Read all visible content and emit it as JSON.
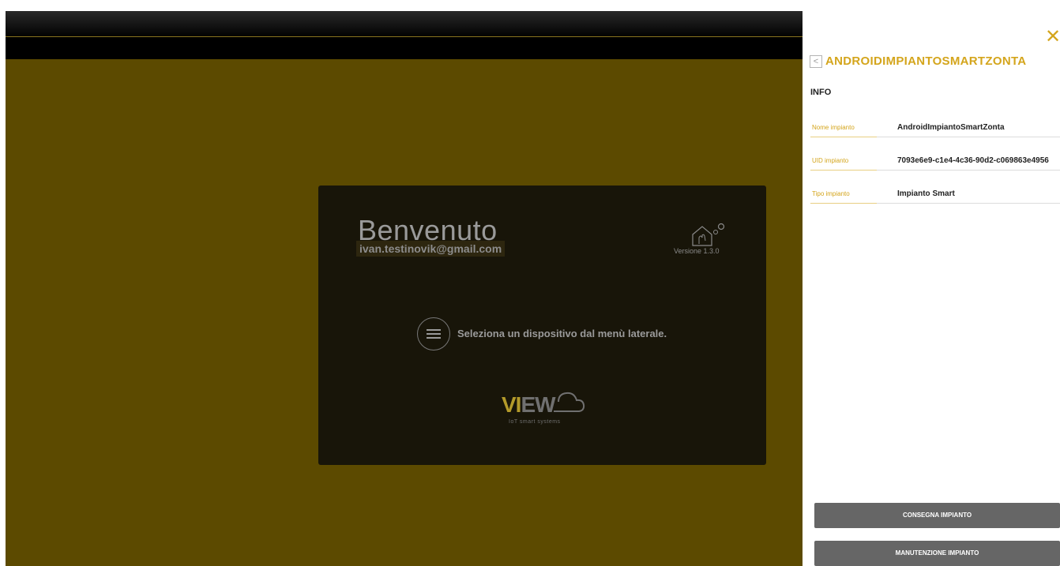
{
  "main": {
    "welcome": {
      "title": "Benvenuto",
      "email": "ivan.testinovik@gmail.com",
      "version": "Versione 1.3.0",
      "hint": "Seleziona un dispositivo dal menù laterale.",
      "logo_vi": "VI",
      "logo_ew": "EW",
      "logo_sub": "IoT smart systems"
    }
  },
  "panel": {
    "title": "ANDROIDIMPIANTOSMARTZONTA",
    "section": "INFO",
    "rows": [
      {
        "label": "Nome impianto",
        "value": "AndroidImpiantoSmartZonta"
      },
      {
        "label": "UID impianto",
        "value": "7093e6e9-c1e4-4c36-90d2-c069863e4956"
      },
      {
        "label": "Tipo impianto",
        "value": "Impianto Smart"
      }
    ],
    "buttons": {
      "consegna": "CONSEGNA IMPIANTO",
      "manutenzione": "MANUTENZIONE IMPIANTO"
    }
  },
  "colors": {
    "accent": "#d4a51c",
    "background": "#5c4a00",
    "button": "#666666"
  }
}
